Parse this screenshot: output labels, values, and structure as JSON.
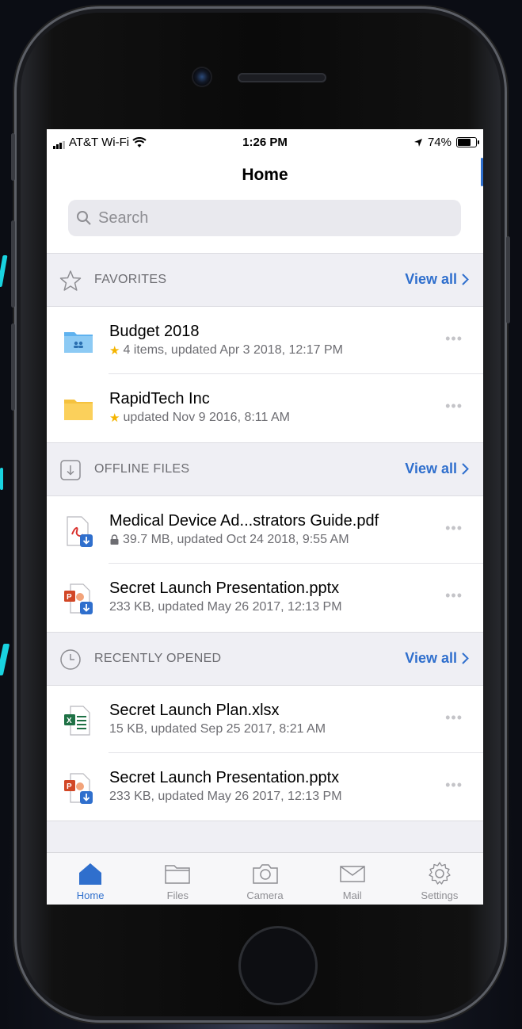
{
  "status_bar": {
    "carrier": "AT&T Wi-Fi",
    "time": "1:26 PM",
    "battery": "74%",
    "battery_level": 0.74
  },
  "header": {
    "title": "Home"
  },
  "search": {
    "placeholder": "Search"
  },
  "sections": {
    "favorites": {
      "label": "FAVORITES",
      "view_all": "View all",
      "items": [
        {
          "name": "Budget 2018",
          "meta": "4 items, updated Apr 3 2018, 12:17 PM",
          "icon": "shared-folder-icon",
          "starred": true
        },
        {
          "name": "RapidTech Inc",
          "meta": "updated Nov 9 2016, 8:11 AM",
          "icon": "folder-icon",
          "starred": true
        }
      ]
    },
    "offline": {
      "label": "OFFLINE FILES",
      "view_all": "View all",
      "items": [
        {
          "name": "Medical Device Ad...strators Guide.pdf",
          "meta": "39.7 MB, updated Oct 24 2018, 9:55 AM",
          "icon": "pdf-file-icon",
          "locked": true
        },
        {
          "name": "Secret Launch Presentation.pptx",
          "meta": "233 KB, updated May 26 2017, 12:13 PM",
          "icon": "pptx-file-icon"
        }
      ]
    },
    "recent": {
      "label": "RECENTLY OPENED",
      "view_all": "View all",
      "items": [
        {
          "name": "Secret Launch Plan.xlsx",
          "meta": "15 KB, updated Sep 25 2017, 8:21 AM",
          "icon": "xlsx-file-icon"
        },
        {
          "name": "Secret Launch Presentation.pptx",
          "meta": "233 KB, updated May 26 2017, 12:13 PM",
          "icon": "pptx-file-icon"
        }
      ]
    }
  },
  "more_glyph": "•••",
  "tabs": [
    {
      "label": "Home",
      "icon": "home-icon",
      "active": true
    },
    {
      "label": "Files",
      "icon": "folder-outline-icon"
    },
    {
      "label": "Camera",
      "icon": "camera-icon"
    },
    {
      "label": "Mail",
      "icon": "mail-icon"
    },
    {
      "label": "Settings",
      "icon": "gear-icon"
    }
  ],
  "colors": {
    "accent": "#2f6fcd",
    "section_bg": "#efeff4",
    "star": "#f4b400",
    "folder_yellow": "#fbd05b",
    "folder_blue": "#5fb2ef"
  }
}
